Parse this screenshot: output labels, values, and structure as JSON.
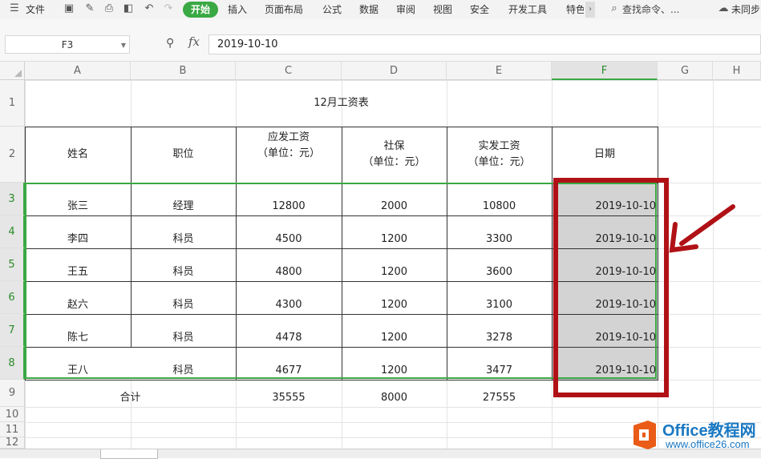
{
  "toolbar": {
    "file_label": "文件",
    "tabs": [
      "开始",
      "插入",
      "页面布局",
      "公式",
      "数据",
      "审阅",
      "视图",
      "安全",
      "开发工具",
      "特色"
    ],
    "more_label": "›",
    "search_placeholder": "查找命令、...",
    "cloud_label": "未同步"
  },
  "formula_bar": {
    "cell_ref": "F3",
    "fx_label": "fx",
    "value": "2019-10-10"
  },
  "columns": [
    "A",
    "B",
    "C",
    "D",
    "E",
    "F",
    "G",
    "H"
  ],
  "selected_column": "F",
  "rows": [
    "1",
    "2",
    "3",
    "4",
    "5",
    "6",
    "7",
    "8",
    "9",
    "10",
    "11",
    "12"
  ],
  "selected_rows": [
    "3",
    "4",
    "5",
    "6",
    "7",
    "8"
  ],
  "sheet": {
    "title": "12月工资表",
    "headers": {
      "name": "姓名",
      "position": "职位",
      "gross": "应发工资",
      "gross_unit": "（单位：元）",
      "insurance": "社保",
      "insurance_unit": "（单位：元）",
      "net": "实发工资",
      "net_unit": "（单位：元）",
      "date": "日期"
    },
    "records": [
      {
        "name": "张三",
        "position": "经理",
        "gross": "12800",
        "insurance": "2000",
        "net": "10800",
        "date": "2019-10-10"
      },
      {
        "name": "李四",
        "position": "科员",
        "gross": "4500",
        "insurance": "1200",
        "net": "3300",
        "date": "2019-10-10"
      },
      {
        "name": "王五",
        "position": "科员",
        "gross": "4800",
        "insurance": "1200",
        "net": "3600",
        "date": "2019-10-10"
      },
      {
        "name": "赵六",
        "position": "科员",
        "gross": "4300",
        "insurance": "1200",
        "net": "3100",
        "date": "2019-10-10"
      },
      {
        "name": "陈七",
        "position": "科员",
        "gross": "4478",
        "insurance": "1200",
        "net": "3278",
        "date": "2019-10-10"
      },
      {
        "name": "王八",
        "position": "科员",
        "gross": "4677",
        "insurance": "1200",
        "net": "3477",
        "date": "2019-10-10"
      }
    ],
    "total": {
      "label": "合计",
      "gross": "35555",
      "insurance": "8000",
      "net": "27555"
    }
  },
  "colors": {
    "accent": "#3aa843",
    "annotation": "#b01116",
    "watermark": "#1a78c2"
  },
  "watermark": {
    "brand": "Office教程网",
    "url": "www.office26.com"
  }
}
